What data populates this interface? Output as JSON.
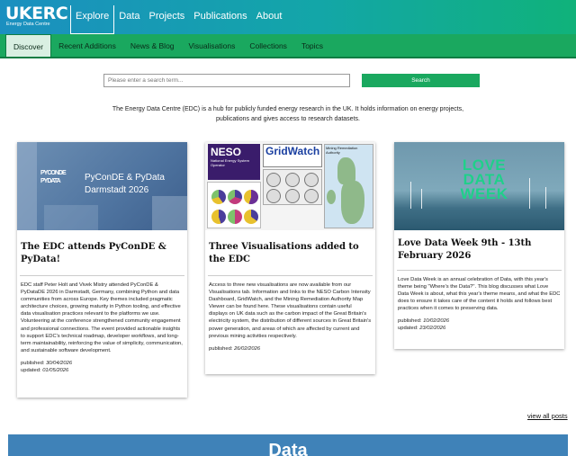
{
  "brand": {
    "logo_text": "UKERC",
    "logo_subtitle": "Energy Data Centre"
  },
  "main_nav": [
    {
      "label": "Explore",
      "active": true
    },
    {
      "label": "Data",
      "active": false
    },
    {
      "label": "Projects",
      "active": false
    },
    {
      "label": "Publications",
      "active": false
    },
    {
      "label": "About",
      "active": false
    }
  ],
  "sub_nav": [
    {
      "label": "Discover",
      "active": true
    },
    {
      "label": "Recent Additions",
      "active": false
    },
    {
      "label": "News & Blog",
      "active": false
    },
    {
      "label": "Visualisations",
      "active": false
    },
    {
      "label": "Collections",
      "active": false
    },
    {
      "label": "Topics",
      "active": false
    }
  ],
  "search": {
    "placeholder": "Please enter a search term...",
    "button_label": "Search"
  },
  "intro_text": "The Energy Data Centre (EDC) is a hub for publicly funded energy research in the UK. It holds information on energy projects, publications and gives access to research datasets.",
  "cards": [
    {
      "image_text": "PyConDE & PyData Darmstadt 2026",
      "image_logo": "PYCONDE PYDATA",
      "title": "The EDC attends PyConDE & PyData!",
      "body": "EDC staff Peter Holt and Vivek Mistry attended PyConDE & PyDataDE 2026 in Darmstadt, Germany, combining Python and data communities from across Europe. Key themes included pragmatic architecture choices, growing maturity in Python tooling, and effective data visualisation practices relevant to the platforms we use. Volunteering at the conference strengthened community engagement and professional connections. The event provided actionable insights to support EDC's technical roadmap, developer workflows, and long-term maintainability, reinforcing the value of simplicity, communication, and sustainable software development.",
      "published_label": "published:",
      "published": "30/04/2026",
      "updated_label": "updated:",
      "updated": "01/05/2026"
    },
    {
      "image_neso": "NESO",
      "image_neso_sub": "National Energy System Operator",
      "image_grid": "GridWatch",
      "image_mining": "Mining Remediation Authority",
      "title": "Three Visualisations added to the EDC",
      "body": "Access to three new visualisations are now available from our Visualisations tab. Information and links to the NESO Carbon Intensity Dashboard, GridWatch, and the Mining Remediation Authority Map Viewer can be found here. These visualisations contain useful displays on UK data such as the carbon impact of the Great Britain's electricity system, the distribution of different sources in Great Britain's power generation, and areas of which are affected by current and previous mining activities respectively.",
      "published_label": "published:",
      "published": "26/02/2026"
    },
    {
      "image_text_1": "LOVE",
      "image_text_2": "DATA",
      "image_text_3": "WEEK",
      "title": "Love Data Week 9th - 13th February 2026",
      "body": "Love Data Week is an annual celebration of Data, with this year's theme being \"Where's the Data?\". This blog discusses what Love Data Week is about, what this year's theme means, and what the EDC does to ensure it takes care of the content it holds and follows best practices when it comes to preserving data.",
      "published_label": "published:",
      "published": "10/02/2026",
      "updated_label": "updated:",
      "updated": "23/02/2026"
    }
  ],
  "view_all_label": "view all posts",
  "data_banner_label": "Data",
  "colors": {
    "nav_start": "#1b8fc0",
    "nav_end": "#10b27a",
    "subnav": "#1aa85f",
    "search_button": "#1aa85f",
    "banner": "#3f82b8"
  }
}
